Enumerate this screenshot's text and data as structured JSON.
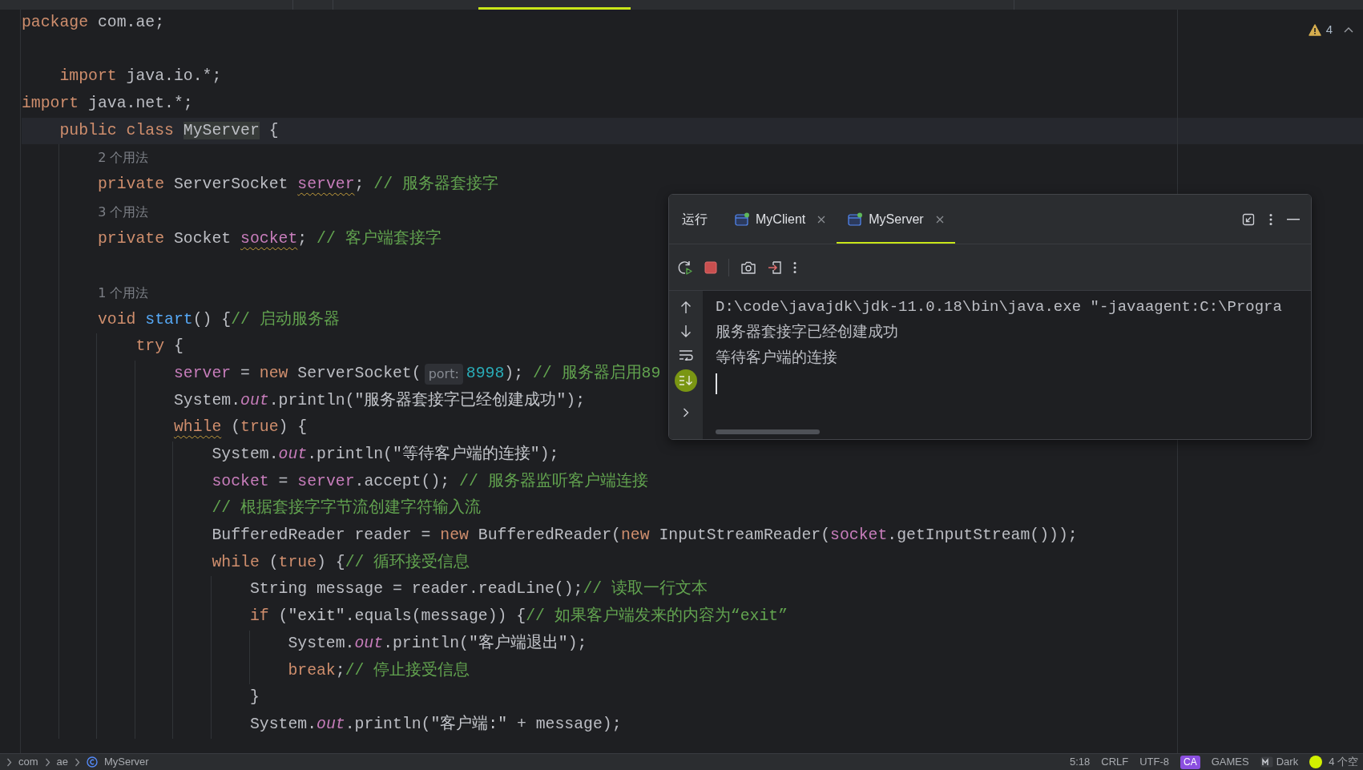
{
  "editor": {
    "warnings": "4",
    "lines": [
      {
        "kind": "code",
        "segments": [
          {
            "kind": "keyword",
            "text": "package"
          },
          {
            "kind": "plain",
            "text": " com.ae;"
          }
        ]
      },
      {
        "kind": "blank"
      },
      {
        "kind": "code",
        "segments": [
          {
            "kind": "keyword",
            "text": "    import"
          },
          {
            "kind": "plain",
            "text": " java.io.*;"
          }
        ]
      },
      {
        "kind": "code",
        "segments": [
          {
            "kind": "keyword",
            "text": "import"
          },
          {
            "kind": "plain",
            "text": " java.net.*;"
          }
        ]
      },
      {
        "kind": "code",
        "current": true,
        "segments": [
          {
            "kind": "keyword",
            "text": "    public class "
          },
          {
            "kind": "plain",
            "text": "MyServer",
            "highlighted": true
          },
          {
            "kind": "plain",
            "text": " {"
          }
        ]
      },
      {
        "kind": "hint",
        "text": "2 个用法"
      },
      {
        "kind": "code",
        "segments": [
          {
            "kind": "keyword",
            "text": "        private"
          },
          {
            "kind": "plain",
            "text": " ServerSocket "
          },
          {
            "kind": "field",
            "text": "server",
            "warning": true
          },
          {
            "kind": "plain",
            "text": "; "
          },
          {
            "kind": "comment",
            "text": "// 服务器套接字"
          }
        ]
      },
      {
        "kind": "hint",
        "text": "3 个用法"
      },
      {
        "kind": "code",
        "segments": [
          {
            "kind": "keyword",
            "text": "        private"
          },
          {
            "kind": "plain",
            "text": " Socket "
          },
          {
            "kind": "field",
            "text": "socket",
            "warning": true
          },
          {
            "kind": "plain",
            "text": "; "
          },
          {
            "kind": "comment",
            "text": "// 客户端套接字"
          }
        ]
      },
      {
        "kind": "blank"
      },
      {
        "kind": "hint",
        "text": "1 个用法"
      },
      {
        "kind": "code",
        "segments": [
          {
            "kind": "keyword",
            "text": "        void "
          },
          {
            "kind": "declaration",
            "text": "start"
          },
          {
            "kind": "plain",
            "text": "() {"
          },
          {
            "kind": "comment",
            "text": "// 启动服务器"
          }
        ]
      },
      {
        "kind": "code",
        "segments": [
          {
            "kind": "keyword",
            "text": "            try"
          },
          {
            "kind": "plain",
            "text": " {"
          }
        ]
      },
      {
        "kind": "code",
        "segments": [
          {
            "kind": "field",
            "text": "                server"
          },
          {
            "kind": "plain",
            "text": " = "
          },
          {
            "kind": "keyword",
            "text": "new"
          },
          {
            "kind": "plain",
            "text": " ServerSocket("
          },
          {
            "kind": "param_hint",
            "text": "port:"
          },
          {
            "kind": "number",
            "text": "8998"
          },
          {
            "kind": "plain",
            "text": "); "
          },
          {
            "kind": "comment",
            "text": "// 服务器启用89"
          }
        ]
      },
      {
        "kind": "code",
        "segments": [
          {
            "kind": "plain",
            "text": "                System."
          },
          {
            "kind": "static",
            "text": "out"
          },
          {
            "kind": "plain",
            "text": ".println("
          },
          {
            "kind": "string",
            "text": "\"服务器套接字已经创建成功\""
          },
          {
            "kind": "plain",
            "text": ");"
          }
        ]
      },
      {
        "kind": "code",
        "segments": [
          {
            "kind": "keyword",
            "text": "                while",
            "warning": true
          },
          {
            "kind": "plain",
            "text": " ("
          },
          {
            "kind": "keyword",
            "text": "true"
          },
          {
            "kind": "plain",
            "text": ") {"
          }
        ]
      },
      {
        "kind": "code",
        "segments": [
          {
            "kind": "plain",
            "text": "                    System."
          },
          {
            "kind": "static",
            "text": "out"
          },
          {
            "kind": "plain",
            "text": ".println("
          },
          {
            "kind": "string",
            "text": "\"等待客户端的连接\""
          },
          {
            "kind": "plain",
            "text": ");"
          }
        ]
      },
      {
        "kind": "code",
        "segments": [
          {
            "kind": "field",
            "text": "                    socket"
          },
          {
            "kind": "plain",
            "text": " = "
          },
          {
            "kind": "field",
            "text": "server"
          },
          {
            "kind": "plain",
            "text": ".accept(); "
          },
          {
            "kind": "comment",
            "text": "// 服务器监听客户端连接"
          }
        ]
      },
      {
        "kind": "code",
        "segments": [
          {
            "kind": "comment",
            "text": "                    // 根据套接字字节流创建字符输入流"
          }
        ]
      },
      {
        "kind": "code",
        "segments": [
          {
            "kind": "plain",
            "text": "                    BufferedReader reader = "
          },
          {
            "kind": "keyword",
            "text": "new"
          },
          {
            "kind": "plain",
            "text": " BufferedReader("
          },
          {
            "kind": "keyword",
            "text": "new"
          },
          {
            "kind": "plain",
            "text": " InputStreamReader("
          },
          {
            "kind": "field",
            "text": "socket"
          },
          {
            "kind": "plain",
            "text": ".getInputStream()));"
          }
        ]
      },
      {
        "kind": "code",
        "segments": [
          {
            "kind": "keyword",
            "text": "                    while"
          },
          {
            "kind": "plain",
            "text": " ("
          },
          {
            "kind": "keyword",
            "text": "true"
          },
          {
            "kind": "plain",
            "text": ") {"
          },
          {
            "kind": "comment",
            "text": "// 循环接受信息"
          }
        ]
      },
      {
        "kind": "code",
        "segments": [
          {
            "kind": "plain",
            "text": "                        String message = reader.readLine();"
          },
          {
            "kind": "comment",
            "text": "// 读取一行文本"
          }
        ]
      },
      {
        "kind": "code",
        "segments": [
          {
            "kind": "keyword",
            "text": "                        if"
          },
          {
            "kind": "plain",
            "text": " ("
          },
          {
            "kind": "string",
            "text": "\"exit\""
          },
          {
            "kind": "plain",
            "text": ".equals(message)) {"
          },
          {
            "kind": "comment",
            "text": "// 如果客户端发来的内容为“exit”"
          }
        ]
      },
      {
        "kind": "code",
        "segments": [
          {
            "kind": "plain",
            "text": "                            System."
          },
          {
            "kind": "static",
            "text": "out"
          },
          {
            "kind": "plain",
            "text": ".println("
          },
          {
            "kind": "string",
            "text": "\"客户端退出\""
          },
          {
            "kind": "plain",
            "text": ");"
          }
        ]
      },
      {
        "kind": "code",
        "segments": [
          {
            "kind": "keyword",
            "text": "                            break"
          },
          {
            "kind": "plain",
            "text": ";"
          },
          {
            "kind": "comment",
            "text": "// 停止接受信息"
          }
        ]
      },
      {
        "kind": "code",
        "segments": [
          {
            "kind": "plain",
            "text": "                        }"
          }
        ]
      },
      {
        "kind": "code",
        "segments": [
          {
            "kind": "plain",
            "text": "                        System."
          },
          {
            "kind": "static",
            "text": "out"
          },
          {
            "kind": "plain",
            "text": ".println("
          },
          {
            "kind": "string",
            "text": "\"客户端:\""
          },
          {
            "kind": "plain",
            "text": " + message);"
          }
        ]
      }
    ]
  },
  "run_panel": {
    "title": "运行",
    "tabs": [
      {
        "label": "MyClient",
        "selected": false
      },
      {
        "label": "MyServer",
        "selected": true
      }
    ],
    "soft_wrap": {
      "on": false
    },
    "scroll_to_end": {
      "on": true
    },
    "console_lines": [
      "D:\\code\\javajdk\\jdk-11.0.18\\bin\\java.exe \"-javaagent:C:\\Progra",
      "服务器套接字已经创建成功",
      "等待客户端的连接"
    ]
  },
  "status_bar": {
    "breadcrumbs": [
      "com",
      "ae",
      "MyServer"
    ],
    "items": [
      {
        "kind": "text",
        "text": "5:18"
      },
      {
        "kind": "text",
        "text": "CRLF"
      },
      {
        "kind": "text",
        "text": "UTF-8"
      },
      {
        "kind": "badge",
        "text": "CA"
      },
      {
        "kind": "text",
        "text": "GAMES"
      },
      {
        "kind": "theme",
        "text": "Dark"
      },
      {
        "kind": "indicator",
        "text": "4 个空"
      }
    ]
  }
}
